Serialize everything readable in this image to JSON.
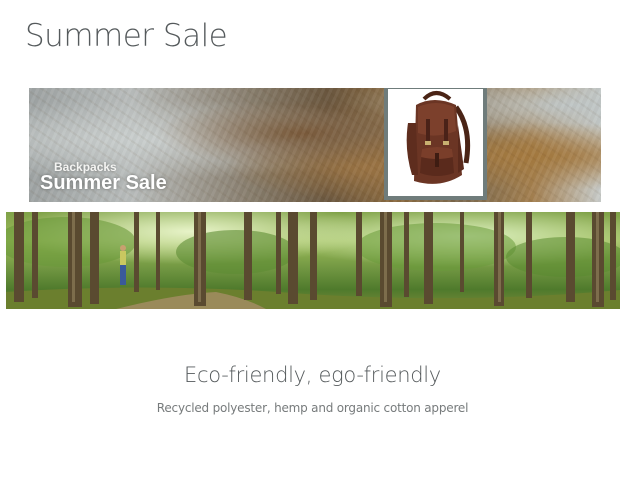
{
  "page": {
    "title": "Summer Sale"
  },
  "banner": {
    "subtitle": "Backpacks",
    "title": "Summer Sale",
    "product": "backpack"
  },
  "forest": {
    "image": "forest-path-photo"
  },
  "promo": {
    "heading": "Eco-friendly, ego-friendly",
    "subtext": "Recycled polyester, hemp and organic cotton apperel"
  }
}
